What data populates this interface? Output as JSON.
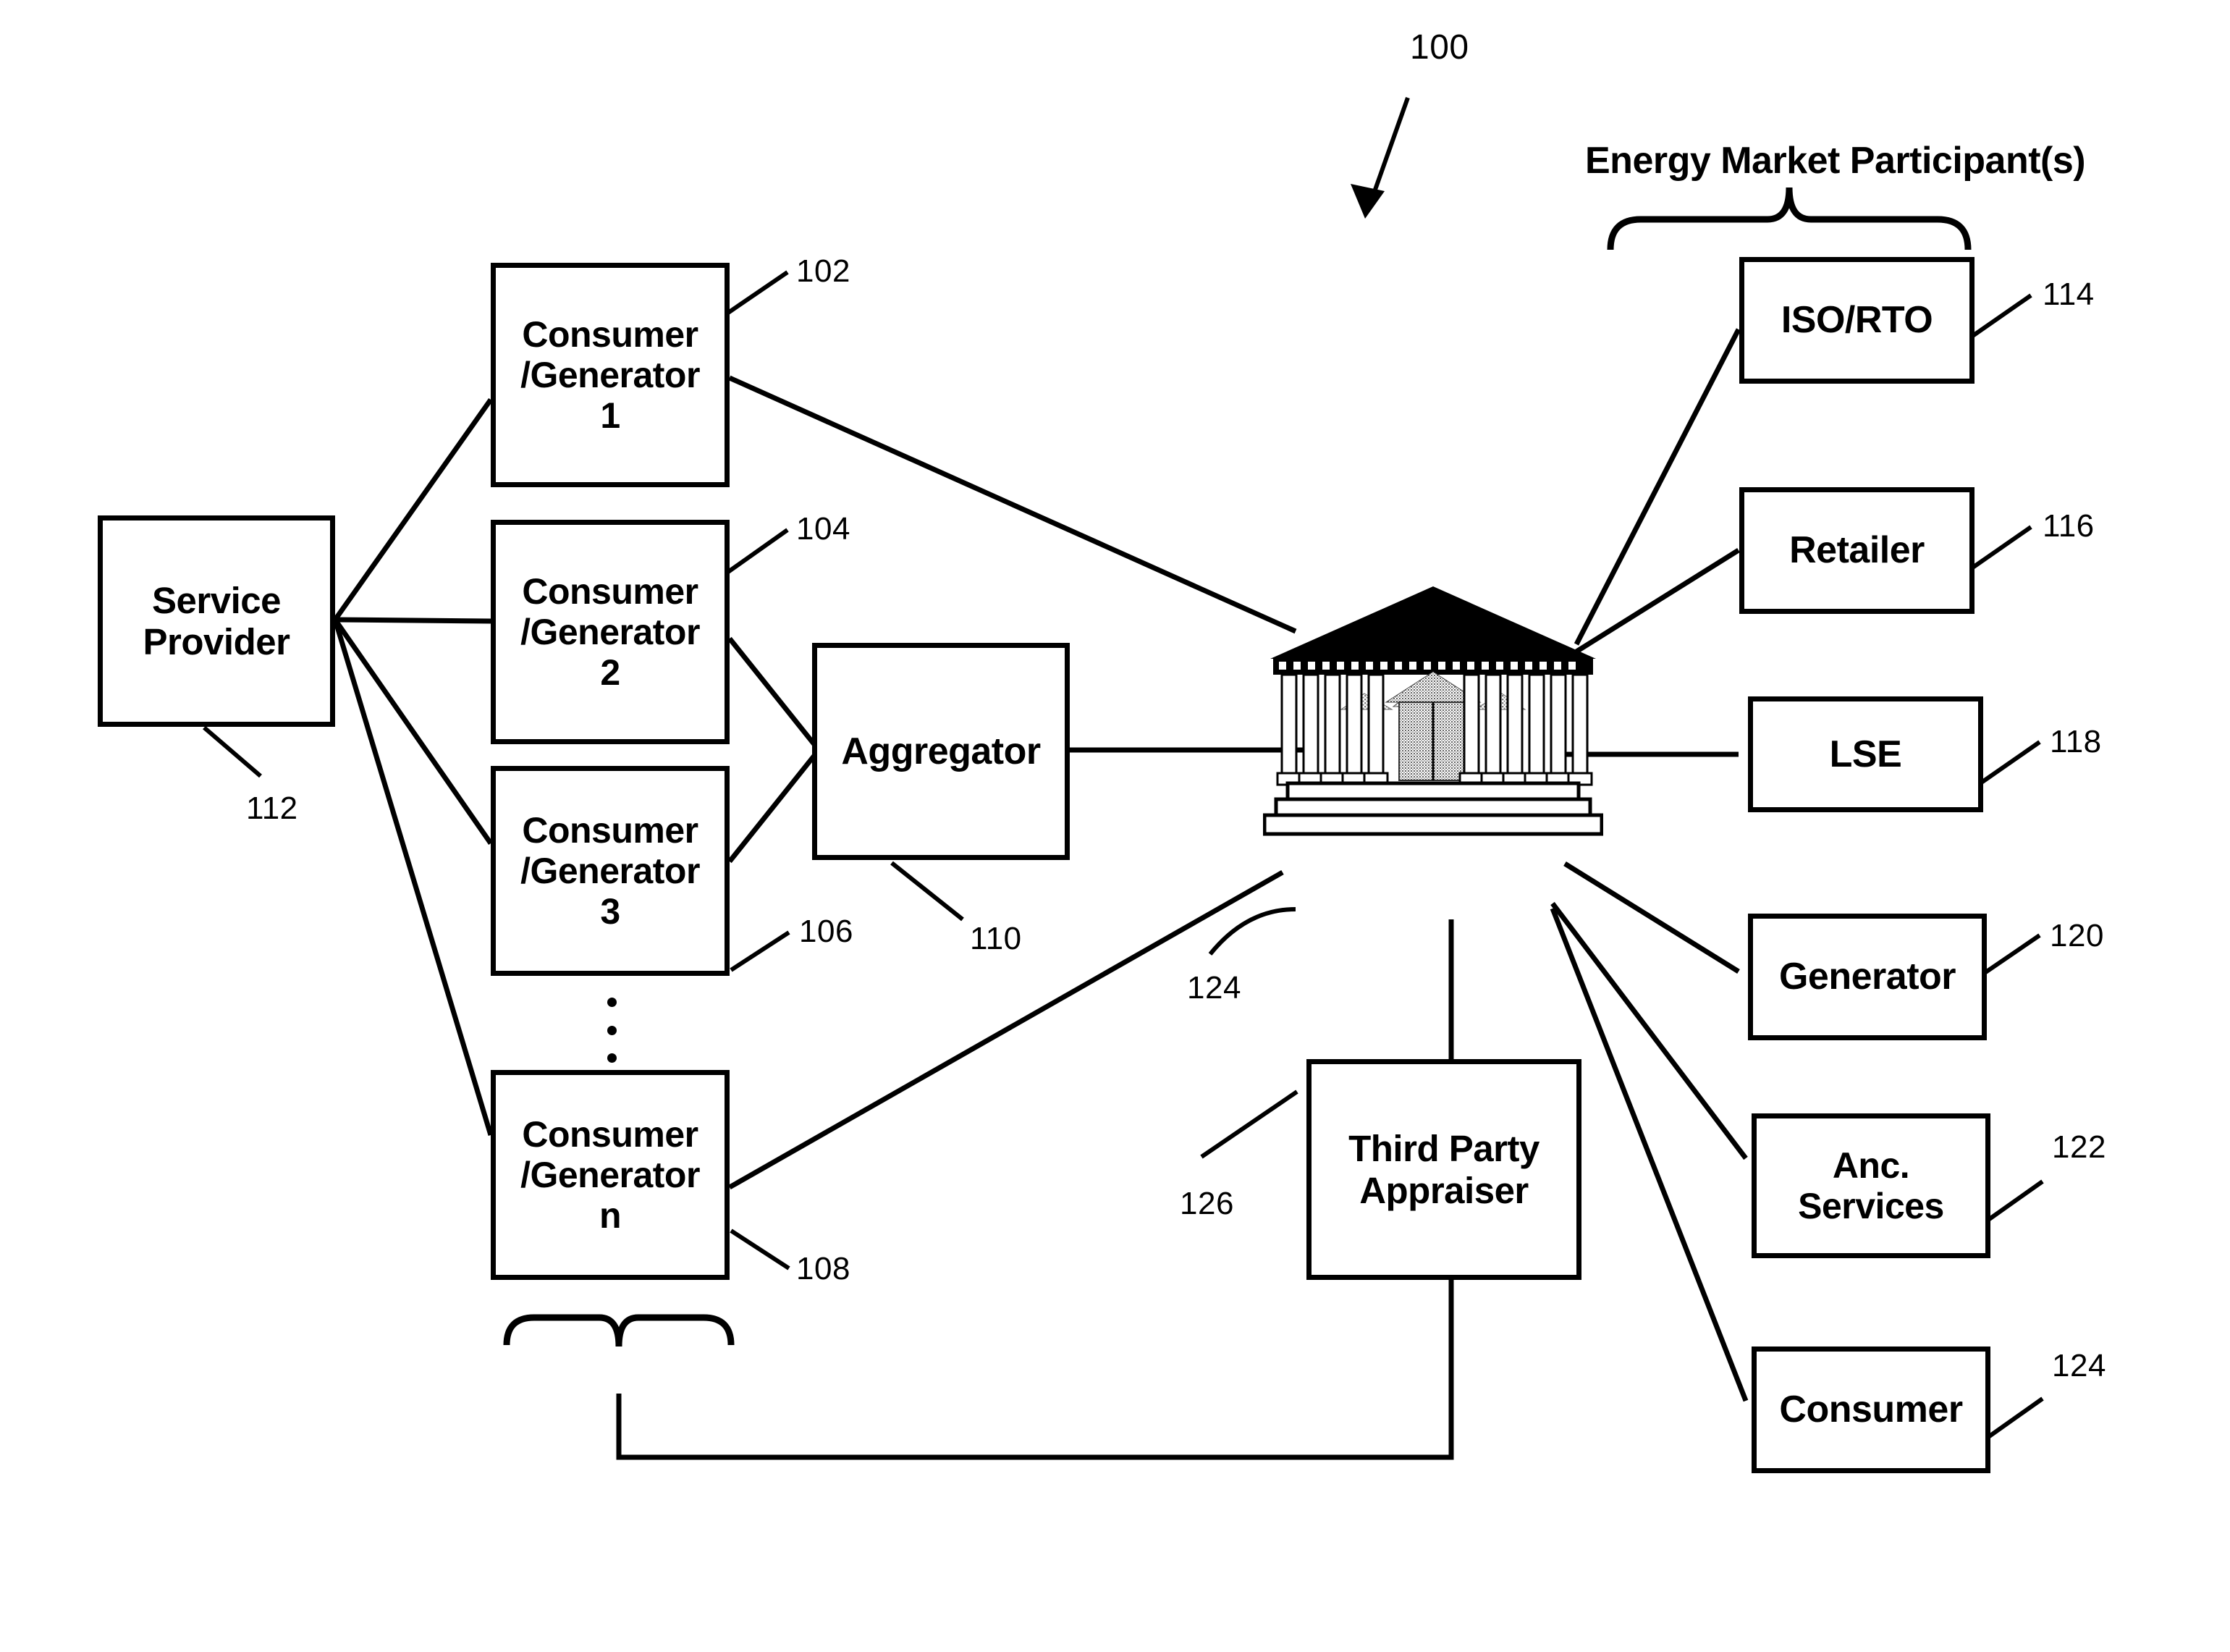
{
  "figure": {
    "reference_numeral": "100",
    "group_title": "Energy Market Participant(s)"
  },
  "nodes": {
    "service_provider": {
      "label": "Service\nProvider",
      "ref": "112"
    },
    "consumer_generator_1": {
      "label": "Consumer\n/Generator\n1",
      "ref": "102"
    },
    "consumer_generator_2": {
      "label": "Consumer\n/Generator\n2",
      "ref": "104"
    },
    "consumer_generator_3": {
      "label": "Consumer\n/Generator\n3",
      "ref": "106"
    },
    "consumer_generator_n": {
      "label": "Consumer\n/Generator\nn",
      "ref": "108"
    },
    "aggregator": {
      "label": "Aggregator",
      "ref": "110"
    },
    "exchange": {
      "label": "",
      "ref": "124"
    },
    "third_party_appraiser": {
      "label": "Third Party\nAppraiser",
      "ref": "126"
    },
    "iso_rto": {
      "label": "ISO/RTO",
      "ref": "114"
    },
    "retailer": {
      "label": "Retailer",
      "ref": "116"
    },
    "lse": {
      "label": "LSE",
      "ref": "118"
    },
    "generator": {
      "label": "Generator",
      "ref": "120"
    },
    "anc_services": {
      "label": "Anc.\nServices",
      "ref": "122"
    },
    "consumer": {
      "label": "Consumer",
      "ref": "124"
    }
  },
  "colors": {
    "ink": "#000000",
    "paper": "#ffffff"
  }
}
